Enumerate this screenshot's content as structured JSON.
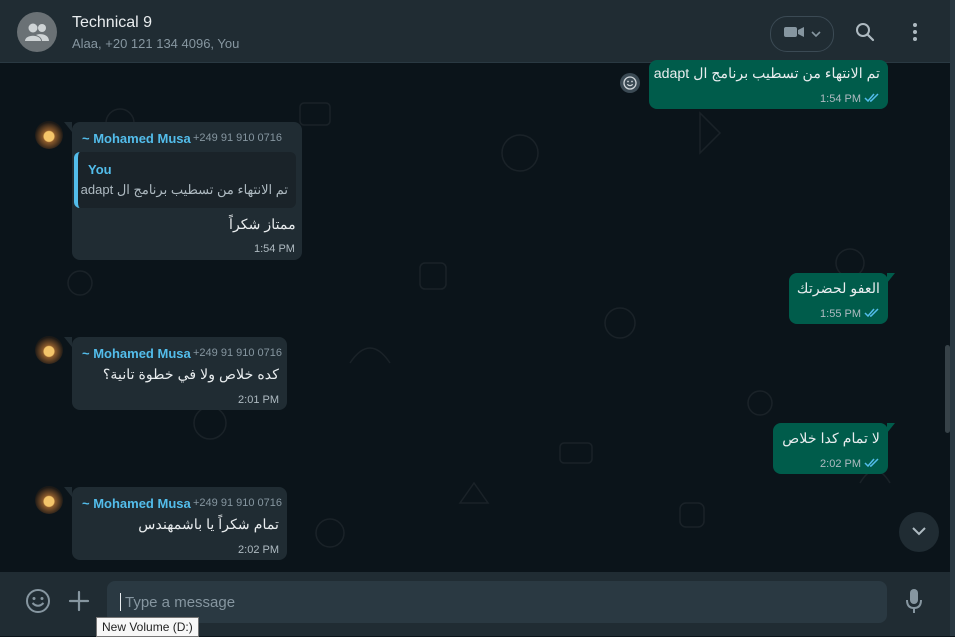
{
  "header": {
    "title": "Technical 9",
    "subtitle": "Alaa, +20 121 134 4096, You"
  },
  "messages": [
    {
      "direction": "out",
      "text": "تم الانتهاء من تسطيب برنامج ال adapt",
      "time": "1:54 PM",
      "status": "read"
    },
    {
      "direction": "in",
      "sender": "~ Mohamed Musa",
      "phone": "+249 91 910 0716",
      "quote": {
        "author": "You",
        "text": "تم الانتهاء من تسطيب برنامج ال adapt"
      },
      "text": "ممتاز شكراً",
      "time": "1:54 PM"
    },
    {
      "direction": "out",
      "text": "العفو لحضرتك",
      "time": "1:55 PM",
      "status": "read"
    },
    {
      "direction": "in",
      "sender": "~ Mohamed Musa",
      "phone": "+249 91 910 0716",
      "text": "كده خلاص ولا في خطوة تانية؟",
      "time": "2:01 PM"
    },
    {
      "direction": "out",
      "text": "لا تمام كدا خلاص",
      "time": "2:02 PM",
      "status": "read"
    },
    {
      "direction": "in",
      "sender": "~ Mohamed Musa",
      "phone": "+249 91 910 0716",
      "text": "تمام شكراً يا باشمهندس",
      "time": "2:02 PM"
    }
  ],
  "composer": {
    "placeholder": "Type a message"
  },
  "tooltip": "New Volume (D:)",
  "icons": {
    "group_avatar": "group-avatar-icon",
    "video": "video-call-icon",
    "dropdown": "chevron-down-icon",
    "search": "search-icon",
    "menu": "menu-dots-icon",
    "emoji": "emoji-icon",
    "attach": "plus-icon",
    "mic": "microphone-icon",
    "read_receipt": "double-check-icon",
    "reaction": "reaction-smiley-icon",
    "scroll_down": "scroll-down-icon"
  },
  "colors": {
    "outgoing_bubble": "#005c4b",
    "incoming_bubble": "#202c33",
    "sender_name": "#53bdeb",
    "read_check": "#53bdeb",
    "background": "#0b141a"
  }
}
